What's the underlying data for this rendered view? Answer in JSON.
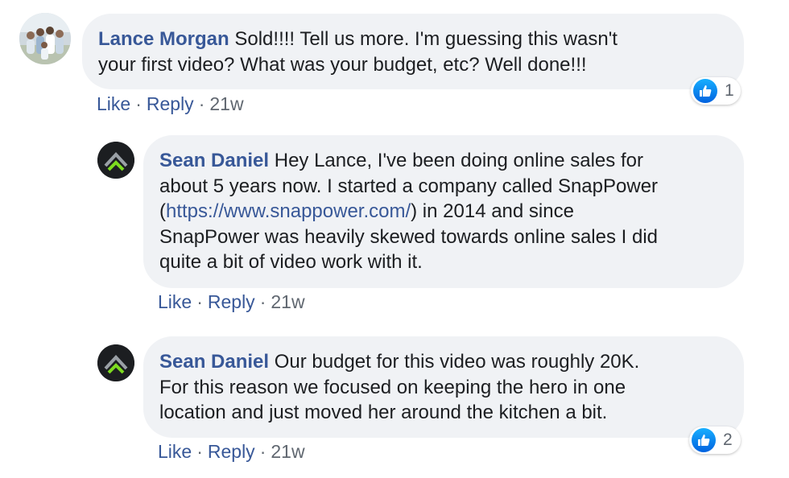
{
  "comments": [
    {
      "author": "Lance Morgan",
      "text_line1": " Sold!!!! Tell us more. I'm guessing this wasn't",
      "text_line2": "your first video? What was your budget, etc? Well done!!!",
      "actions": {
        "like": "Like",
        "reply": "Reply",
        "time": "21w",
        "sep": "·"
      },
      "reaction_count": "1",
      "avatar_icon": "family-photo-avatar"
    },
    {
      "author": "Sean Daniel",
      "text_line1": " Hey Lance, I've been doing online sales for",
      "text_line2": "about 5 years now. I started a company called SnapPower",
      "text_line3_pre": "(",
      "link": "https://www.snappower.com/",
      "text_line3_post": ") in 2014 and since",
      "text_line4": "SnapPower was heavily skewed towards online sales I did",
      "text_line5": "quite a bit of video work with it.",
      "actions": {
        "like": "Like",
        "reply": "Reply",
        "time": "21w",
        "sep": "·"
      },
      "avatar_icon": "snappower-logo-avatar"
    },
    {
      "author": "Sean Daniel",
      "text_line1": " Our budget for this video was roughly 20K.",
      "text_line2": "For this reason we focused on keeping the hero in one",
      "text_line3": "location and just moved her around the kitchen a bit.",
      "actions": {
        "like": "Like",
        "reply": "Reply",
        "time": "21w",
        "sep": "·"
      },
      "reaction_count": "2",
      "avatar_icon": "snappower-logo-avatar"
    }
  ],
  "colors": {
    "author": "#385898",
    "bubble": "#f0f2f5",
    "like_blue": "#1877f2",
    "logo_green": "#7ddc1f"
  }
}
